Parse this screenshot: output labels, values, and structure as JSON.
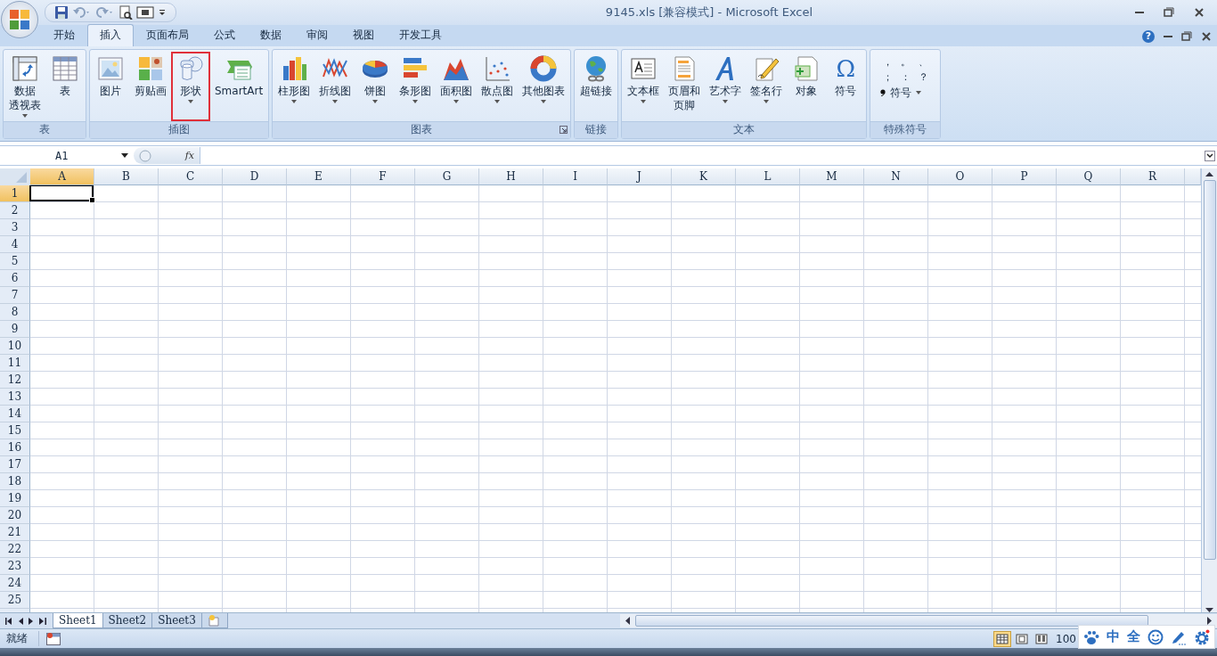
{
  "window": {
    "title": "9145.xls  [兼容模式] - Microsoft Excel"
  },
  "tabs": [
    {
      "label": "开始",
      "selected": false
    },
    {
      "label": "插入",
      "selected": true
    },
    {
      "label": "页面布局",
      "selected": false
    },
    {
      "label": "公式",
      "selected": false
    },
    {
      "label": "数据",
      "selected": false
    },
    {
      "label": "审阅",
      "selected": false
    },
    {
      "label": "视图",
      "selected": false
    },
    {
      "label": "开发工具",
      "selected": false
    }
  ],
  "help_button": "?",
  "ribbon_groups": [
    {
      "label": "表",
      "launcher": false,
      "buttons": [
        {
          "kind": "pivot",
          "lines": [
            "数据",
            "透视表"
          ],
          "dropdown": true,
          "highlighted": false
        },
        {
          "kind": "table",
          "lines": [
            "表"
          ],
          "dropdown": false,
          "highlighted": false
        }
      ]
    },
    {
      "label": "插图",
      "launcher": false,
      "buttons": [
        {
          "kind": "picture",
          "lines": [
            "图片"
          ],
          "dropdown": false,
          "highlighted": false
        },
        {
          "kind": "clipart",
          "lines": [
            "剪贴画"
          ],
          "dropdown": false,
          "highlighted": false
        },
        {
          "kind": "shape",
          "lines": [
            "形状"
          ],
          "dropdown": true,
          "highlighted": true
        },
        {
          "kind": "smartart",
          "lines": [
            "SmartArt"
          ],
          "dropdown": false,
          "highlighted": false
        }
      ]
    },
    {
      "label": "图表",
      "launcher": true,
      "buttons": [
        {
          "kind": "column",
          "lines": [
            "柱形图"
          ],
          "dropdown": true,
          "highlighted": false
        },
        {
          "kind": "line",
          "lines": [
            "折线图"
          ],
          "dropdown": true,
          "highlighted": false
        },
        {
          "kind": "pie",
          "lines": [
            "饼图"
          ],
          "dropdown": true,
          "highlighted": false
        },
        {
          "kind": "bar",
          "lines": [
            "条形图"
          ],
          "dropdown": true,
          "highlighted": false
        },
        {
          "kind": "area",
          "lines": [
            "面积图"
          ],
          "dropdown": true,
          "highlighted": false
        },
        {
          "kind": "scatter",
          "lines": [
            "散点图"
          ],
          "dropdown": true,
          "highlighted": false
        },
        {
          "kind": "donut",
          "lines": [
            "其他图表"
          ],
          "dropdown": true,
          "highlighted": false
        }
      ]
    },
    {
      "label": "链接",
      "launcher": false,
      "buttons": [
        {
          "kind": "globe",
          "lines": [
            "超链接"
          ],
          "dropdown": false,
          "highlighted": false
        }
      ]
    },
    {
      "label": "文本",
      "launcher": false,
      "buttons": [
        {
          "kind": "textbox",
          "lines": [
            "文本框"
          ],
          "dropdown": true,
          "highlighted": false
        },
        {
          "kind": "header",
          "lines": [
            "页眉和",
            "页脚"
          ],
          "dropdown": false,
          "highlighted": false
        },
        {
          "kind": "wordart",
          "lines": [
            "艺术字"
          ],
          "dropdown": true,
          "highlighted": false
        },
        {
          "kind": "signature",
          "lines": [
            "签名行"
          ],
          "dropdown": true,
          "highlighted": false
        },
        {
          "kind": "object",
          "lines": [
            "对象"
          ],
          "dropdown": false,
          "highlighted": false
        },
        {
          "kind": "omega",
          "glyph": "Ω",
          "lines": [
            "符号"
          ],
          "dropdown": false,
          "highlighted": false
        }
      ]
    },
    {
      "label": "特殊符号",
      "launcher": false,
      "symbols": [
        "，",
        "。",
        "、",
        "；",
        "：",
        "？"
      ],
      "symbol_button": {
        "label": "符号",
        "dropdown": true
      }
    }
  ],
  "formula_bar": {
    "name_box": "A1",
    "fx": "fx"
  },
  "columns": [
    {
      "label": "A",
      "selected": true
    },
    {
      "label": "B",
      "selected": false
    },
    {
      "label": "C",
      "selected": false
    },
    {
      "label": "D",
      "selected": false
    },
    {
      "label": "E",
      "selected": false
    },
    {
      "label": "F",
      "selected": false
    },
    {
      "label": "G",
      "selected": false
    },
    {
      "label": "H",
      "selected": false
    },
    {
      "label": "I",
      "selected": false
    },
    {
      "label": "J",
      "selected": false
    },
    {
      "label": "K",
      "selected": false
    },
    {
      "label": "L",
      "selected": false
    },
    {
      "label": "M",
      "selected": false
    },
    {
      "label": "N",
      "selected": false
    },
    {
      "label": "O",
      "selected": false
    },
    {
      "label": "P",
      "selected": false
    },
    {
      "label": "Q",
      "selected": false
    },
    {
      "label": "R",
      "selected": false
    }
  ],
  "rows": [
    {
      "label": "1",
      "selected": true
    },
    {
      "label": "2",
      "selected": false
    },
    {
      "label": "3",
      "selected": false
    },
    {
      "label": "4",
      "selected": false
    },
    {
      "label": "5",
      "selected": false
    },
    {
      "label": "6",
      "selected": false
    },
    {
      "label": "7",
      "selected": false
    },
    {
      "label": "8",
      "selected": false
    },
    {
      "label": "9",
      "selected": false
    },
    {
      "label": "10",
      "selected": false
    },
    {
      "label": "11",
      "selected": false
    },
    {
      "label": "12",
      "selected": false
    },
    {
      "label": "13",
      "selected": false
    },
    {
      "label": "14",
      "selected": false
    },
    {
      "label": "15",
      "selected": false
    },
    {
      "label": "16",
      "selected": false
    },
    {
      "label": "17",
      "selected": false
    },
    {
      "label": "18",
      "selected": false
    },
    {
      "label": "19",
      "selected": false
    },
    {
      "label": "20",
      "selected": false
    },
    {
      "label": "21",
      "selected": false
    },
    {
      "label": "22",
      "selected": false
    },
    {
      "label": "23",
      "selected": false
    },
    {
      "label": "24",
      "selected": false
    },
    {
      "label": "25",
      "selected": false
    }
  ],
  "sheet_tabs": [
    {
      "label": "Sheet1",
      "selected": true
    },
    {
      "label": "Sheet2",
      "selected": false
    },
    {
      "label": "Sheet3",
      "selected": false
    }
  ],
  "status_bar": {
    "status": "就绪",
    "zoom": "100",
    "views": [
      {
        "selected": true
      },
      {
        "selected": false
      },
      {
        "selected": false
      }
    ]
  },
  "ime_toolbar": {
    "items": [
      {
        "kind": "paw"
      },
      {
        "kind": "text",
        "label": "中"
      },
      {
        "kind": "text",
        "label": "全"
      },
      {
        "kind": "smiley"
      },
      {
        "kind": "pen"
      },
      {
        "kind": "gear"
      }
    ]
  }
}
